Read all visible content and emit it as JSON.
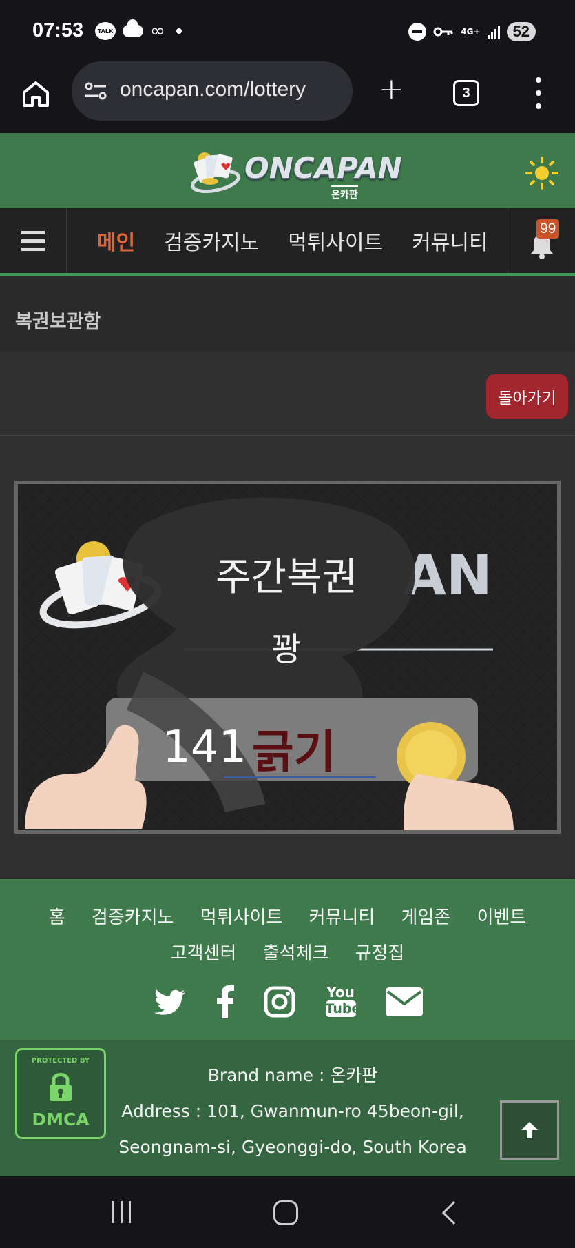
{
  "status_bar": {
    "time": "07:53",
    "talk_label": "TALK",
    "network": "4G+",
    "battery": "52"
  },
  "browser": {
    "url": "oncapan.com/lottery",
    "tab_count": "3"
  },
  "header": {
    "logo_text": "ONCAPAN",
    "logo_subtext": "온카판"
  },
  "nav": {
    "items": [
      {
        "label": "메인",
        "active": true
      },
      {
        "label": "검증카지노",
        "active": false
      },
      {
        "label": "먹튀사이트",
        "active": false
      },
      {
        "label": "커뮤니티",
        "active": false
      }
    ],
    "notification_count": "99"
  },
  "page": {
    "title": "복권보관함",
    "back_button": "돌아가기"
  },
  "lottery": {
    "title": "주간복권",
    "result": "꽝",
    "number": "141",
    "scratch_label": "긁기"
  },
  "footer": {
    "links_row1": [
      "홈",
      "검증카지노",
      "먹튀사이트",
      "커뮤니티",
      "게임존",
      "이벤트"
    ],
    "links_row2": [
      "고객센터",
      "출석체크",
      "규정집"
    ],
    "social": [
      "twitter-icon",
      "facebook-icon",
      "instagram-icon",
      "youtube-icon",
      "email-icon"
    ],
    "youtube_label_top": "You",
    "youtube_label_bottom": "Tube"
  },
  "info": {
    "dmca_top": "PROTECTED BY",
    "dmca_bottom": "DMCA",
    "brand": "Brand name : 온카판",
    "address_line1": "Address : 101, Gwanmun-ro 45beon-gil,",
    "address_line2": "Seongnam-si, Gyeonggi-do, South Korea"
  },
  "colors": {
    "header_green": "#3e7a4b",
    "nav_active": "#e06536",
    "back_button": "#a1262e",
    "badge": "#c9532b"
  }
}
